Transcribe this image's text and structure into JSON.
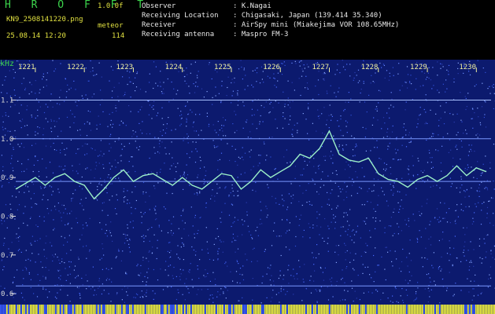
{
  "header": {
    "brand": "H R O F F T",
    "version": "1.0.0f",
    "filename": "KN9_2508141220.png",
    "mode": "meteor",
    "datetime": "25.08.14 12:20",
    "count": "114",
    "meta": [
      {
        "label": "Observer",
        "value": ": K.Nagai"
      },
      {
        "label": "Receiving Location",
        "value": ": Chigasaki, Japan (139.414 35.340)"
      },
      {
        "label": "Receiver",
        "value": ": AirSpy mini (Miakejima VOR 108.65MHz)"
      },
      {
        "label": "Receiving antenna",
        "value": ": Maspro FM-3"
      }
    ]
  },
  "chart_data": {
    "type": "heatmap",
    "ylabel": "kHz",
    "y_ticks": [
      "1.1",
      "1.0",
      "0.9",
      "0.8",
      "0.7",
      "0.6"
    ],
    "x_ticks": [
      "1221",
      "1222",
      "1223",
      "1224",
      "1225",
      "1226",
      "1227",
      "1228",
      "1229",
      "1230"
    ],
    "ylim": [
      0.58,
      1.18
    ],
    "xlim": [
      1220.6,
      1230.3
    ],
    "horizontal_lines_khz": [
      1.1,
      1.0,
      0.89,
      0.62
    ],
    "colors": {
      "background": "#0c1a6e",
      "noise": "#4a6cff",
      "trace": "#9cf0c8",
      "line": "#c8d8ff",
      "axis_label": "#f0f0a0"
    },
    "trace": [
      {
        "x": 1220.6,
        "y": 0.87
      },
      {
        "x": 1220.8,
        "y": 0.885
      },
      {
        "x": 1221.0,
        "y": 0.9
      },
      {
        "x": 1221.2,
        "y": 0.88
      },
      {
        "x": 1221.4,
        "y": 0.9
      },
      {
        "x": 1221.6,
        "y": 0.91
      },
      {
        "x": 1221.8,
        "y": 0.89
      },
      {
        "x": 1222.0,
        "y": 0.88
      },
      {
        "x": 1222.2,
        "y": 0.845
      },
      {
        "x": 1222.4,
        "y": 0.87
      },
      {
        "x": 1222.6,
        "y": 0.9
      },
      {
        "x": 1222.8,
        "y": 0.92
      },
      {
        "x": 1223.0,
        "y": 0.89
      },
      {
        "x": 1223.2,
        "y": 0.905
      },
      {
        "x": 1223.4,
        "y": 0.91
      },
      {
        "x": 1223.6,
        "y": 0.895
      },
      {
        "x": 1223.8,
        "y": 0.88
      },
      {
        "x": 1224.0,
        "y": 0.9
      },
      {
        "x": 1224.2,
        "y": 0.88
      },
      {
        "x": 1224.4,
        "y": 0.87
      },
      {
        "x": 1224.6,
        "y": 0.89
      },
      {
        "x": 1224.8,
        "y": 0.91
      },
      {
        "x": 1225.0,
        "y": 0.905
      },
      {
        "x": 1225.2,
        "y": 0.87
      },
      {
        "x": 1225.4,
        "y": 0.89
      },
      {
        "x": 1225.6,
        "y": 0.92
      },
      {
        "x": 1225.8,
        "y": 0.9
      },
      {
        "x": 1226.0,
        "y": 0.915
      },
      {
        "x": 1226.2,
        "y": 0.93
      },
      {
        "x": 1226.4,
        "y": 0.96
      },
      {
        "x": 1226.6,
        "y": 0.95
      },
      {
        "x": 1226.8,
        "y": 0.975
      },
      {
        "x": 1227.0,
        "y": 1.02
      },
      {
        "x": 1227.2,
        "y": 0.96
      },
      {
        "x": 1227.4,
        "y": 0.945
      },
      {
        "x": 1227.6,
        "y": 0.94
      },
      {
        "x": 1227.8,
        "y": 0.95
      },
      {
        "x": 1228.0,
        "y": 0.91
      },
      {
        "x": 1228.2,
        "y": 0.895
      },
      {
        "x": 1228.4,
        "y": 0.89
      },
      {
        "x": 1228.6,
        "y": 0.875
      },
      {
        "x": 1228.8,
        "y": 0.895
      },
      {
        "x": 1229.0,
        "y": 0.905
      },
      {
        "x": 1229.2,
        "y": 0.89
      },
      {
        "x": 1229.4,
        "y": 0.905
      },
      {
        "x": 1229.6,
        "y": 0.93
      },
      {
        "x": 1229.8,
        "y": 0.905
      },
      {
        "x": 1230.0,
        "y": 0.925
      },
      {
        "x": 1230.2,
        "y": 0.915
      }
    ]
  }
}
